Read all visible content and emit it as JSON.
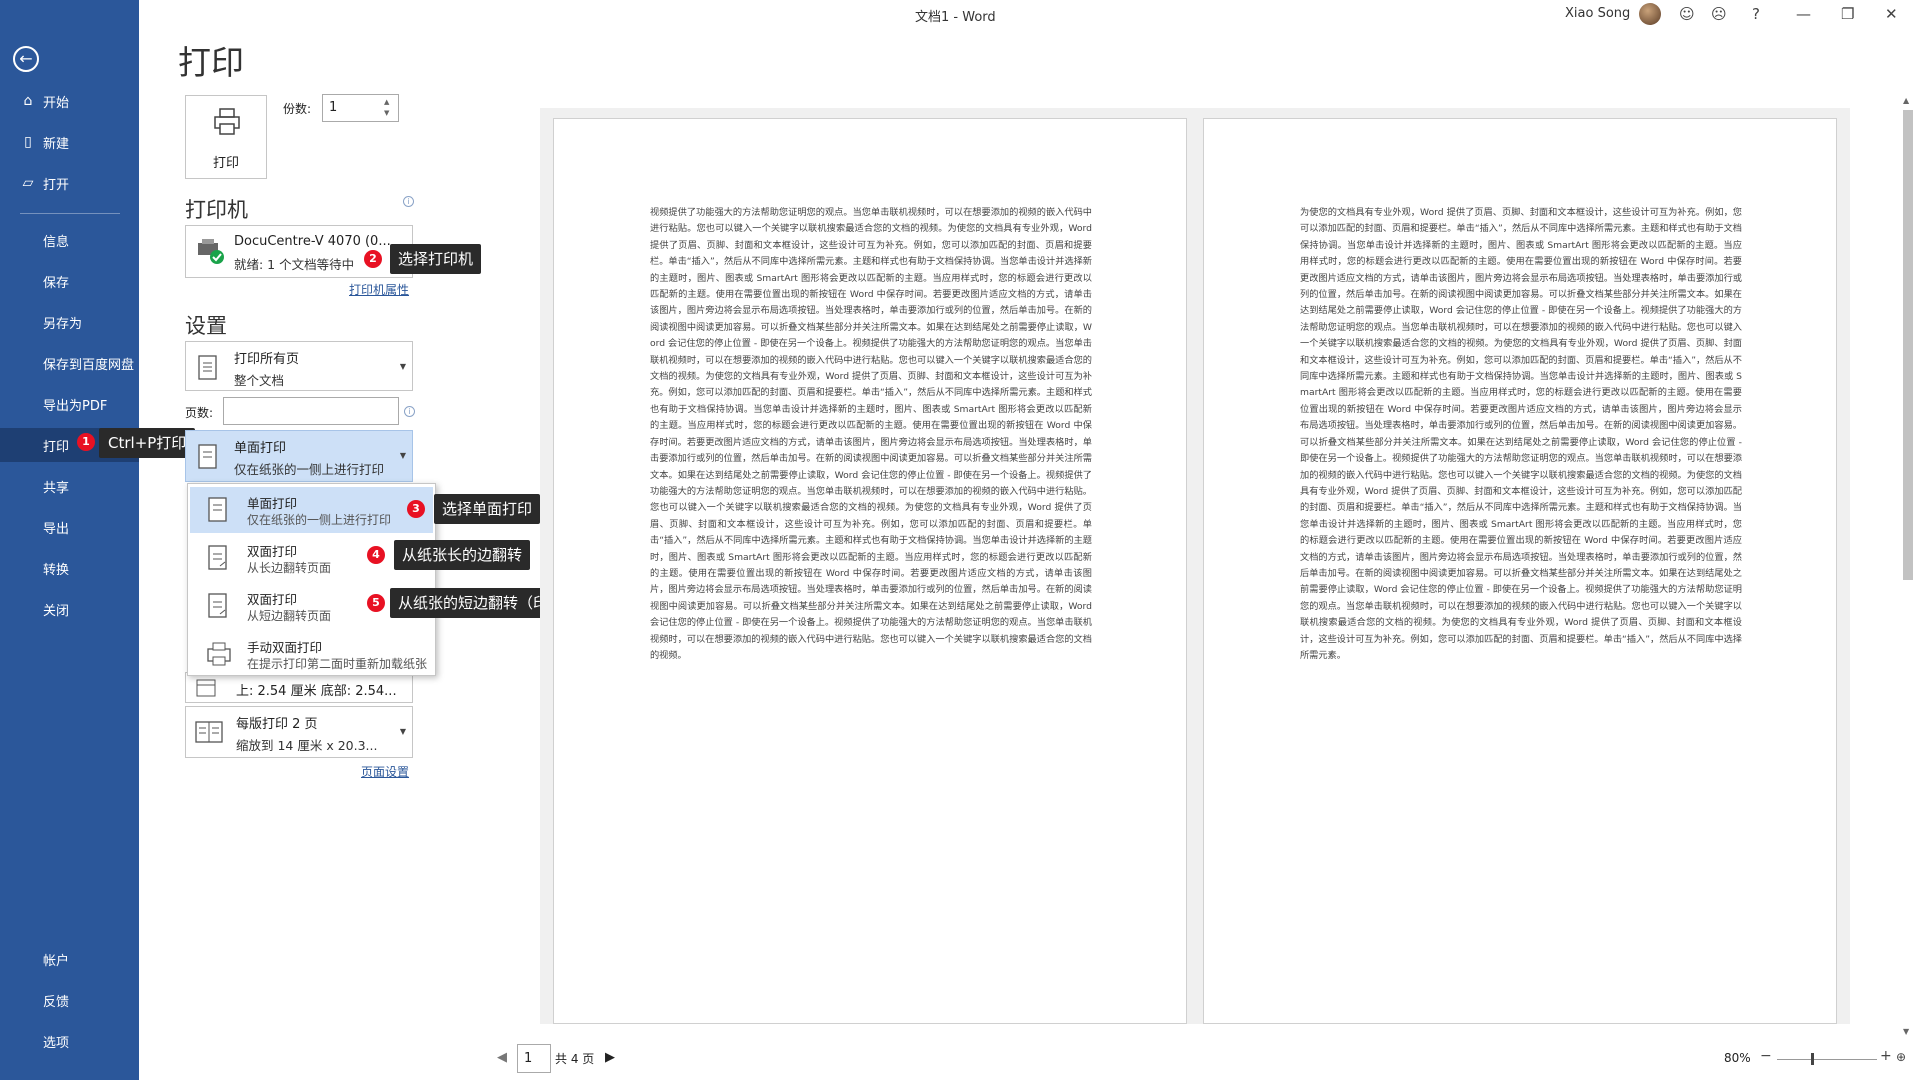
{
  "window": {
    "title": "文档1 - Word",
    "user_name": "Xiao Song",
    "title_icons": [
      "smiley-icon",
      "frown-icon",
      "help-icon",
      "minimize-icon",
      "restore-icon",
      "close-icon"
    ],
    "title_glyphs": [
      "☺",
      "☹",
      "?",
      "—",
      "❐",
      "✕"
    ]
  },
  "colors": {
    "accent": "#2b579a",
    "badge": "#e81123",
    "callout_bg": "#2a2a2a",
    "selected": "#cde0f7"
  },
  "sidebar": {
    "items": [
      {
        "label": "开始",
        "icon": "home-icon"
      },
      {
        "label": "新建",
        "icon": "new-doc-icon"
      },
      {
        "label": "打开",
        "icon": "open-folder-icon"
      },
      {
        "label": "信息"
      },
      {
        "label": "保存"
      },
      {
        "label": "另存为"
      },
      {
        "label": "保存到百度网盘"
      },
      {
        "label": "导出为PDF"
      },
      {
        "label": "打印",
        "active": true,
        "badge": "1"
      },
      {
        "label": "共享"
      },
      {
        "label": "导出"
      },
      {
        "label": "转换"
      },
      {
        "label": "关闭"
      }
    ],
    "bottom_items": [
      {
        "label": "帐户"
      },
      {
        "label": "反馈"
      },
      {
        "label": "选项"
      }
    ],
    "print_callout": "Ctrl+P打印"
  },
  "print": {
    "page_title": "打印",
    "print_button_label": "打印",
    "copies_label": "份数:",
    "copies_value": "1"
  },
  "printer": {
    "heading": "打印机",
    "name": "DocuCentre-V 4070 (0...",
    "status": "就绪: 1 个文档等待中",
    "badge": "2",
    "callout": "选择打印机",
    "properties_link": "打印机属性"
  },
  "settings": {
    "heading": "设置",
    "range_main": "打印所有页",
    "range_sub": "整个文档",
    "pages_label": "页数:",
    "pages_value": "",
    "sided_main": "单面打印",
    "sided_sub": "仅在纸张的一侧上进行打印",
    "menu": [
      {
        "main": "单面打印",
        "sub": "仅在纸张的一侧上进行打印",
        "badge": "3",
        "callout": "选择单面打印"
      },
      {
        "main": "双面打印",
        "sub": "从长边翻转页面",
        "badge": "4",
        "callout": "从纸张长的边翻转"
      },
      {
        "main": "双面打印",
        "sub": "从短边翻转页面",
        "badge": "5",
        "callout": "从纸张的短边翻转（印制试卷，我们一般选择短边翻转）"
      },
      {
        "main": "手动双面打印",
        "sub": "在提示打印第二面时重新加载纸张"
      }
    ],
    "margins_text": "上: 2.54 厘米 底部: 2.54...",
    "pps_main": "每版打印 2 页",
    "pps_sub": "缩放到 14 厘米 x 20.3...",
    "page_setup_link": "页面设置"
  },
  "preview": {
    "page1_text": "视频提供了功能强大的方法帮助您证明您的观点。当您单击联机视频时，可以在想要添加的视频的嵌入代码中进行粘贴。您也可以键入一个关键字以联机搜索最适合您的文档的视频。为使您的文档具有专业外观，Word 提供了页眉、页脚、封面和文本框设计，这些设计可互为补充。例如，您可以添加匹配的封面、页眉和提要栏。单击“插入”，然后从不同库中选择所需元素。主题和样式也有助于文档保持协调。当您单击设计并选择新的主题时，图片、图表或 SmartArt 图形将会更改以匹配新的主题。当应用样式时，您的标题会进行更改以匹配新的主题。使用在需要位置出现的新按钮在 Word 中保存时间。若要更改图片适应文档的方式，请单击该图片，图片旁边将会显示布局选项按钮。当处理表格时，单击要添加行或列的位置，然后单击加号。在新的阅读视图中阅读更加容易。可以折叠文档某些部分并关注所需文本。如果在达到结尾处之前需要停止读取，Word 会记住您的停止位置 - 即使在另一个设备上。视频提供了功能强大的方法帮助您证明您的观点。当您单击联机视频时，可以在想要添加的视频的嵌入代码中进行粘贴。您也可以键入一个关键字以联机搜索最适合您的文档的视频。为使您的文档具有专业外观，Word 提供了页眉、页脚、封面和文本框设计，这些设计可互为补充。例如，您可以添加匹配的封面、页眉和提要栏。单击“插入”，然后从不同库中选择所需元素。主题和样式也有助于文档保持协调。当您单击设计并选择新的主题时，图片、图表或 SmartArt 图形将会更改以匹配新的主题。当应用样式时，您的标题会进行更改以匹配新的主题。使用在需要位置出现的新按钮在 Word 中保存时间。若要更改图片适应文档的方式，请单击该图片，图片旁边将会显示布局选项按钮。当处理表格时，单击要添加行或列的位置，然后单击加号。在新的阅读视图中阅读更加容易。可以折叠文档某些部分并关注所需文本。如果在达到结尾处之前需要停止读取，Word 会记住您的停止位置 - 即使在另一个设备上。视频提供了功能强大的方法帮助您证明您的观点。当您单击联机视频时，可以在想要添加的视频的嵌入代码中进行粘贴。您也可以键入一个关键字以联机搜索最适合您的文档的视频。为使您的文档具有专业外观，Word 提供了页眉、页脚、封面和文本框设计，这些设计可互为补充。例如，您可以添加匹配的封面、页眉和提要栏。单击“插入”，然后从不同库中选择所需元素。主题和样式也有助于文档保持协调。当您单击设计并选择新的主题时，图片、图表或 SmartArt 图形将会更改以匹配新的主题。当应用样式时，您的标题会进行更改以匹配新的主题。使用在需要位置出现的新按钮在 Word 中保存时间。若要更改图片适应文档的方式，请单击该图片，图片旁边将会显示布局选项按钮。当处理表格时，单击要添加行或列的位置，然后单击加号。在新的阅读视图中阅读更加容易。可以折叠文档某些部分并关注所需文本。如果在达到结尾处之前需要停止读取，Word 会记住您的停止位置 - 即使在另一个设备上。视频提供了功能强大的方法帮助您证明您的观点。当您单击联机视频时，可以在想要添加的视频的嵌入代码中进行粘贴。您也可以键入一个关键字以联机搜索最适合您的文档的视频。",
    "page2_text": "为使您的文档具有专业外观，Word 提供了页眉、页脚、封面和文本框设计，这些设计可互为补充。例如，您可以添加匹配的封面、页眉和提要栏。单击“插入”，然后从不同库中选择所需元素。主题和样式也有助于文档保持协调。当您单击设计并选择新的主题时，图片、图表或 SmartArt 图形将会更改以匹配新的主题。当应用样式时，您的标题会进行更改以匹配新的主题。使用在需要位置出现的新按钮在 Word 中保存时间。若要更改图片适应文档的方式，请单击该图片，图片旁边将会显示布局选项按钮。当处理表格时，单击要添加行或列的位置，然后单击加号。在新的阅读视图中阅读更加容易。可以折叠文档某些部分并关注所需文本。如果在达到结尾处之前需要停止读取，Word 会记住您的停止位置 - 即使在另一个设备上。视频提供了功能强大的方法帮助您证明您的观点。当您单击联机视频时，可以在想要添加的视频的嵌入代码中进行粘贴。您也可以键入一个关键字以联机搜索最适合您的文档的视频。为使您的文档具有专业外观，Word 提供了页眉、页脚、封面和文本框设计，这些设计可互为补充。例如，您可以添加匹配的封面、页眉和提要栏。单击“插入”，然后从不同库中选择所需元素。主题和样式也有助于文档保持协调。当您单击设计并选择新的主题时，图片、图表或 SmartArt 图形将会更改以匹配新的主题。当应用样式时，您的标题会进行更改以匹配新的主题。使用在需要位置出现的新按钮在 Word 中保存时间。若要更改图片适应文档的方式，请单击该图片，图片旁边将会显示布局选项按钮。当处理表格时，单击要添加行或列的位置，然后单击加号。在新的阅读视图中阅读更加容易。可以折叠文档某些部分并关注所需文本。如果在达到结尾处之前需要停止读取，Word 会记住您的停止位置 - 即使在另一个设备上。视频提供了功能强大的方法帮助您证明您的观点。当您单击联机视频时，可以在想要添加的视频的嵌入代码中进行粘贴。您也可以键入一个关键字以联机搜索最适合您的文档的视频。为使您的文档具有专业外观，Word 提供了页眉、页脚、封面和文本框设计，这些设计可互为补充。例如，您可以添加匹配的封面、页眉和提要栏。单击“插入”，然后从不同库中选择所需元素。主题和样式也有助于文档保持协调。当您单击设计并选择新的主题时，图片、图表或 SmartArt 图形将会更改以匹配新的主题。当应用样式时，您的标题会进行更改以匹配新的主题。使用在需要位置出现的新按钮在 Word 中保存时间。若要更改图片适应文档的方式，请单击该图片，图片旁边将会显示布局选项按钮。当处理表格时，单击要添加行或列的位置，然后单击加号。在新的阅读视图中阅读更加容易。可以折叠文档某些部分并关注所需文本。如果在达到结尾处之前需要停止读取，Word 会记住您的停止位置 - 即使在另一个设备上。视频提供了功能强大的方法帮助您证明您的观点。当您单击联机视频时，可以在想要添加的视频的嵌入代码中进行粘贴。您也可以键入一个关键字以联机搜索最适合您的文档的视频。为使您的文档具有专业外观，Word 提供了页眉、页脚、封面和文本框设计，这些设计可互为补充。例如，您可以添加匹配的封面、页眉和提要栏。单击“插入”，然后从不同库中选择所需元素。",
    "current_page": "1",
    "total_pages": "共 4 页",
    "zoom": "80%"
  }
}
